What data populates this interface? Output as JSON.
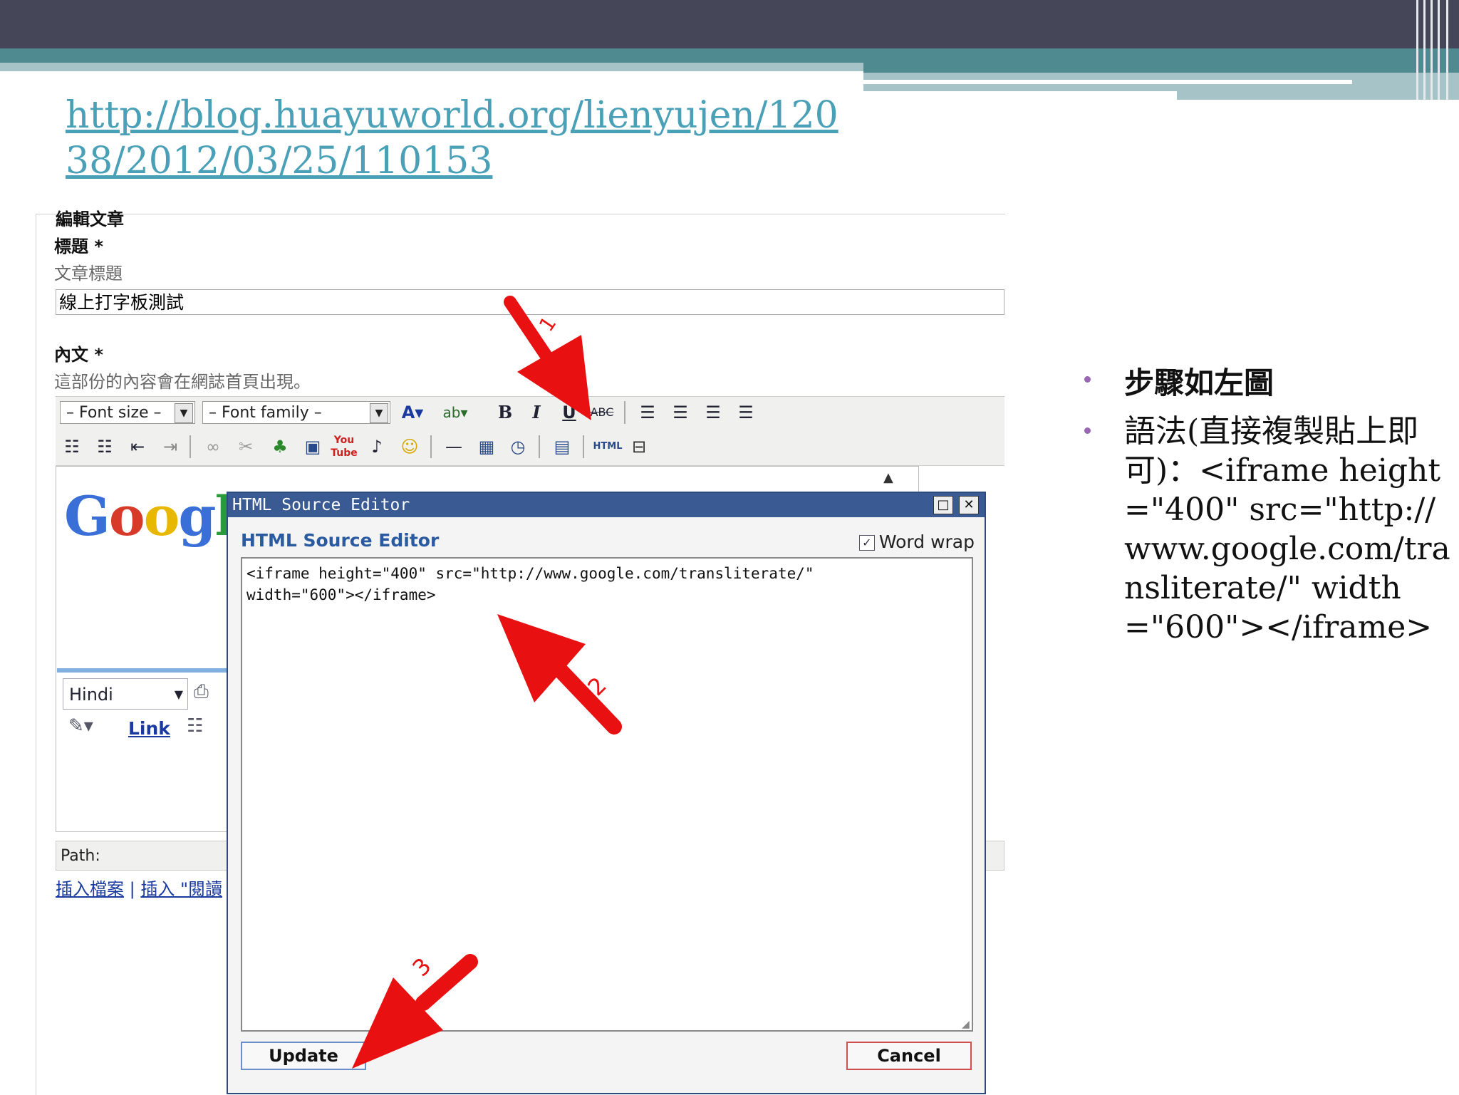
{
  "slide": {
    "url_link": "http://blog.huayuworld.org/lienyujen/12038/2012/03/25/110153",
    "bullets": [
      "步驟如左圖",
      "語法(直接複製貼上即可)：<iframe height=\"400\" src=\"http://www.google.com/transliterate/\" width=\"600\"></iframe>"
    ],
    "colors": {
      "header_dark": "#454658",
      "header_teal": "#4e8a8f",
      "link": "#4aa1b7",
      "bullet": "#9a68b3",
      "arrow": "#e81010"
    }
  },
  "editor": {
    "section_title": "編輯文章",
    "title_label": "標題 *",
    "title_hint": "文章標題",
    "title_value": "線上打字板測試",
    "body_label": "內文 *",
    "body_hint": "這部份的內容會在網誌首頁出現。",
    "toolbar": {
      "font_size": "– Font size –",
      "font_family": "– Font family –",
      "html_button": "HTML"
    },
    "embed": {
      "logo": "Google",
      "language_select": "Hindi",
      "link_button": "Link"
    },
    "path_label": "Path:",
    "insert_file_link": "插入檔案",
    "insert_read_link": "插入 \"閱讀"
  },
  "dialog": {
    "title": "HTML Source Editor",
    "heading": "HTML Source Editor",
    "word_wrap_label": "Word wrap",
    "word_wrap_checked": true,
    "source_code": "<iframe height=\"400\" src=\"http://www.google.com/transliterate/\"\nwidth=\"600\"></iframe>",
    "update_label": "Update",
    "cancel_label": "Cancel"
  },
  "annotations": [
    "1",
    "2",
    "3"
  ]
}
